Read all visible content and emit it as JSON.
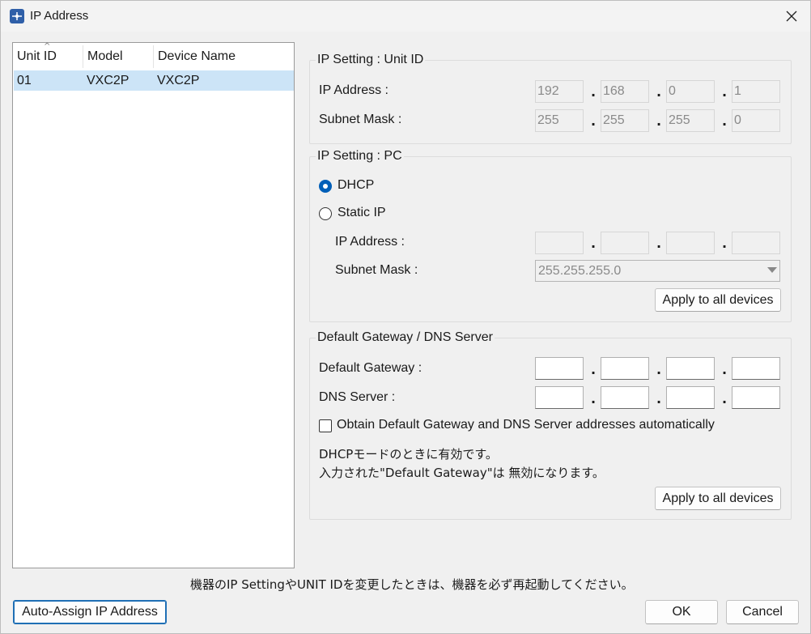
{
  "window": {
    "title": "IP Address",
    "close_icon": "close-icon",
    "app_icon": "ip-address-app-icon"
  },
  "device_list": {
    "columns": [
      "Unit ID",
      "Model",
      "Device Name"
    ],
    "sort_indicator": "^",
    "rows": [
      {
        "unit_id": "01",
        "model": "VXC2P",
        "device_name": "VXC2P",
        "selected": true
      }
    ]
  },
  "unit_id_group": {
    "title": "IP Setting : Unit ID",
    "ip_label": "IP Address :",
    "ip": [
      "192",
      "168",
      "0",
      "1"
    ],
    "mask_label": "Subnet Mask :",
    "mask": [
      "255",
      "255",
      "255",
      "0"
    ]
  },
  "pc_group": {
    "title": "IP Setting : PC",
    "dhcp_label": "DHCP",
    "dhcp_checked": true,
    "static_label": "Static IP",
    "static_checked": false,
    "ip_label": "IP Address :",
    "ip": [
      "",
      "",
      "",
      ""
    ],
    "mask_label": "Subnet Mask :",
    "mask_value": "255.255.255.0",
    "apply_label": "Apply to all devices"
  },
  "gateway_group": {
    "title": "Default Gateway / DNS Server",
    "gateway_label": "Default Gateway :",
    "gateway": [
      "",
      "",
      "",
      ""
    ],
    "dns_label": "DNS Server :",
    "dns": [
      "",
      "",
      "",
      ""
    ],
    "auto_label": "Obtain Default Gateway and DNS Server addresses automatically",
    "auto_checked": false,
    "note_line1": "DHCPモードのときに有効です。",
    "note_line2": "入力された\"Default Gateway\"は 無効になります。",
    "apply_label": "Apply to all devices"
  },
  "footer": {
    "restart_note": "機器のIP SettingやUNIT IDを変更したときは、機器を必ず再起動してください。",
    "auto_assign_label": "Auto-Assign IP Address",
    "ok_label": "OK",
    "cancel_label": "Cancel"
  },
  "colors": {
    "accent": "#005fb8",
    "selection": "#cce4f7"
  }
}
